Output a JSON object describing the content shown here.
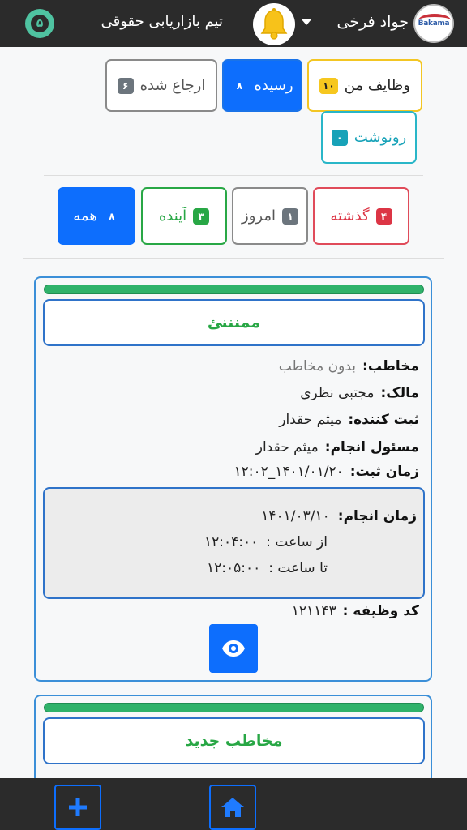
{
  "header": {
    "username": "جواد فرخی",
    "team_name": "تیم بازاریابی حقوقی",
    "team_badge": "۵",
    "logo_text": "Bakama"
  },
  "filters_top": [
    {
      "label": "وظایف من",
      "count": "۱۰"
    },
    {
      "label": "رسیده",
      "count": "۸"
    },
    {
      "label": "ارجاع شده",
      "count": "۶"
    },
    {
      "label": "رونوشت",
      "count": "۰"
    }
  ],
  "filters_time": [
    {
      "label": "گذشته",
      "count": "۴"
    },
    {
      "label": "امروز",
      "count": "۱"
    },
    {
      "label": "آینده",
      "count": "۳"
    },
    {
      "label": "همه",
      "count": "۸"
    }
  ],
  "cards": [
    {
      "progress": 1.0,
      "subject": "ممنننئ",
      "contact_label": "مخاطب:",
      "contact_value": "بدون مخاطب",
      "owner_label": "مالک:",
      "owner_value": "مجتبی نظری",
      "registrar_label": "ثبت کننده:",
      "registrar_value": "میثم حقدار",
      "responsible_label": "مسئول انجام:",
      "responsible_value": "میثم حقدار",
      "reg_time_label": "زمان ثبت:",
      "reg_time_value": "۱۴۰۱/۰۱/۲۰_۱۲:۰۲",
      "do_time_label": "زمان انجام:",
      "do_time_value": "۱۴۰۱/۰۳/۱۰",
      "from_label": "از ساعت :",
      "from_value": "۱۲:۰۴:۰۰",
      "to_label": "تا ساعت :",
      "to_value": "۱۲:۰۵:۰۰",
      "code_label": "کد وظیفه :",
      "code_value": "۱۲۱۱۴۳"
    },
    {
      "progress": 1.0,
      "subject": "مخاطب جدید"
    }
  ],
  "colors": {
    "primary": "#0d6efd",
    "success": "#28a745",
    "danger": "#dc3545",
    "warning": "#f6c71f",
    "info": "#17a2b8",
    "topbar": "#2b2b2b"
  }
}
